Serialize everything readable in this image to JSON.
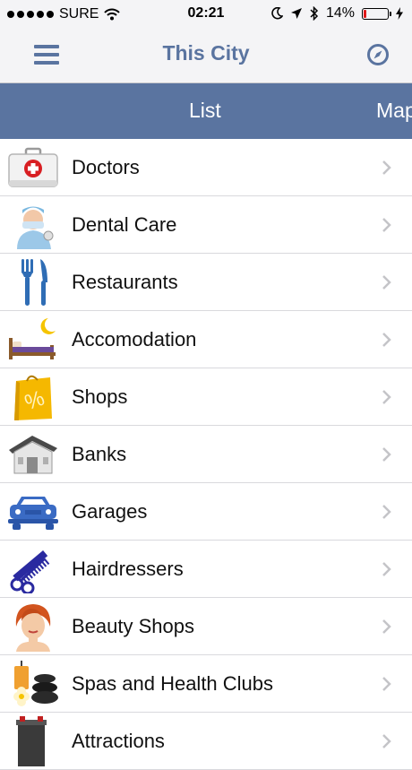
{
  "status_bar": {
    "carrier": "SURE",
    "time": "02:21",
    "battery": "14%",
    "battery_level": 0.14
  },
  "nav": {
    "title": "This City",
    "menu_icon": "hamburger-menu-icon",
    "right_icon": "compass-icon"
  },
  "tabs": {
    "list": "List",
    "map": "Map"
  },
  "list": {
    "items": [
      {
        "label": "Doctors",
        "icon": "first-aid-kit-icon"
      },
      {
        "label": "Dental Care",
        "icon": "dentist-icon"
      },
      {
        "label": "Restaurants",
        "icon": "fork-knife-icon"
      },
      {
        "label": "Accomodation",
        "icon": "bed-moon-icon"
      },
      {
        "label": "Shops",
        "icon": "shopping-bag-icon"
      },
      {
        "label": "Banks",
        "icon": "bank-building-icon"
      },
      {
        "label": "Garages",
        "icon": "car-icon"
      },
      {
        "label": "Hairdressers",
        "icon": "comb-scissors-icon"
      },
      {
        "label": "Beauty Shops",
        "icon": "woman-face-icon"
      },
      {
        "label": "Spas and Health Clubs",
        "icon": "spa-stones-icon"
      },
      {
        "label": "Attractions",
        "icon": "attraction-icon"
      }
    ]
  },
  "colors": {
    "accent": "#5a74a0",
    "bar_background": "#f4f4f6",
    "battery_low": "#e0191a"
  }
}
